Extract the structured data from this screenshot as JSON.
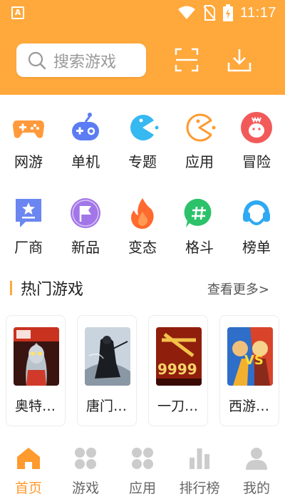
{
  "status_bar": {
    "time": "11:17",
    "app_icon": "A"
  },
  "header": {
    "search_placeholder": "搜索游戏",
    "scan_icon": "scan-icon",
    "download_icon": "download-icon",
    "background": "#ffa83b"
  },
  "categories": [
    {
      "label": "网游",
      "icon": "gamepad-icon",
      "color": "#ff9a3c"
    },
    {
      "label": "单机",
      "icon": "controller-icon",
      "color": "#5b7cf2"
    },
    {
      "label": "专题",
      "icon": "pacman-icon",
      "color": "#36b8f0"
    },
    {
      "label": "应用",
      "icon": "pacman-outline-icon",
      "color": "#ff9a2e"
    },
    {
      "label": "冒险",
      "icon": "face-icon",
      "color": "#f25a5a"
    },
    {
      "label": "厂商",
      "icon": "star-badge-icon",
      "color": "#6b86f0"
    },
    {
      "label": "新品",
      "icon": "flag-icon",
      "color": "#a276e8"
    },
    {
      "label": "变态",
      "icon": "flame-icon",
      "color": "#ff6a2e"
    },
    {
      "label": "格斗",
      "icon": "hash-chat-icon",
      "color": "#2cc26a"
    },
    {
      "label": "榜单",
      "icon": "headset-icon",
      "color": "#2fa9f2"
    }
  ],
  "hot_section": {
    "title": "热门游戏",
    "more_label": "查看更多>"
  },
  "hot_games": [
    {
      "name": "奥特…",
      "thumb": "ultraman-thumb"
    },
    {
      "name": "唐门…",
      "thumb": "tangmen-thumb"
    },
    {
      "name": "一刀…",
      "thumb": "yidao-thumb"
    },
    {
      "name": "西游…",
      "thumb": "xiyou-thumb"
    }
  ],
  "bottom_nav": [
    {
      "label": "首页",
      "icon": "home-icon",
      "active": true
    },
    {
      "label": "游戏",
      "icon": "grid-icon",
      "active": false
    },
    {
      "label": "应用",
      "icon": "apps-icon",
      "active": false
    },
    {
      "label": "排行榜",
      "icon": "bar-chart-icon",
      "active": false
    },
    {
      "label": "我的",
      "icon": "user-icon",
      "active": false
    }
  ],
  "colors": {
    "accent": "#ffa83b",
    "active_nav": "#ff9a2e",
    "inactive_nav": "#cccccc"
  }
}
